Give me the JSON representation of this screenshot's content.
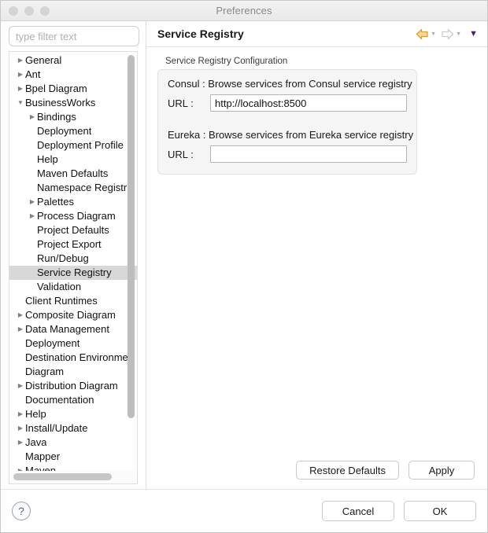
{
  "window": {
    "title": "Preferences",
    "traffic_lights": [
      "close",
      "minimize",
      "zoom"
    ]
  },
  "sidebar": {
    "filter": {
      "value": "",
      "placeholder": "type filter text"
    },
    "tree": [
      {
        "label": "General",
        "level": 0,
        "twisty": "collapsed",
        "selected": false
      },
      {
        "label": "Ant",
        "level": 0,
        "twisty": "collapsed",
        "selected": false
      },
      {
        "label": "Bpel Diagram",
        "level": 0,
        "twisty": "collapsed",
        "selected": false
      },
      {
        "label": "BusinessWorks",
        "level": 0,
        "twisty": "expanded",
        "selected": false
      },
      {
        "label": "Bindings",
        "level": 1,
        "twisty": "collapsed",
        "selected": false
      },
      {
        "label": "Deployment",
        "level": 1,
        "twisty": "none",
        "selected": false
      },
      {
        "label": "Deployment Profile",
        "level": 1,
        "twisty": "none",
        "selected": false
      },
      {
        "label": "Help",
        "level": 1,
        "twisty": "none",
        "selected": false
      },
      {
        "label": "Maven Defaults",
        "level": 1,
        "twisty": "none",
        "selected": false
      },
      {
        "label": "Namespace Registr",
        "level": 1,
        "twisty": "none",
        "selected": false
      },
      {
        "label": "Palettes",
        "level": 1,
        "twisty": "collapsed",
        "selected": false
      },
      {
        "label": "Process Diagram",
        "level": 1,
        "twisty": "collapsed",
        "selected": false
      },
      {
        "label": "Project Defaults",
        "level": 1,
        "twisty": "none",
        "selected": false
      },
      {
        "label": "Project Export",
        "level": 1,
        "twisty": "none",
        "selected": false
      },
      {
        "label": "Run/Debug",
        "level": 1,
        "twisty": "none",
        "selected": false
      },
      {
        "label": "Service Registry",
        "level": 1,
        "twisty": "none",
        "selected": true
      },
      {
        "label": "Validation",
        "level": 1,
        "twisty": "none",
        "selected": false
      },
      {
        "label": "Client Runtimes",
        "level": 0,
        "twisty": "none",
        "selected": false
      },
      {
        "label": "Composite Diagram",
        "level": 0,
        "twisty": "collapsed",
        "selected": false
      },
      {
        "label": "Data Management",
        "level": 0,
        "twisty": "collapsed",
        "selected": false
      },
      {
        "label": "Deployment",
        "level": 0,
        "twisty": "none",
        "selected": false
      },
      {
        "label": "Destination Environme",
        "level": 0,
        "twisty": "none",
        "selected": false
      },
      {
        "label": "Diagram",
        "level": 0,
        "twisty": "none",
        "selected": false
      },
      {
        "label": "Distribution Diagram",
        "level": 0,
        "twisty": "collapsed",
        "selected": false
      },
      {
        "label": "Documentation",
        "level": 0,
        "twisty": "none",
        "selected": false
      },
      {
        "label": "Help",
        "level": 0,
        "twisty": "collapsed",
        "selected": false
      },
      {
        "label": "Install/Update",
        "level": 0,
        "twisty": "collapsed",
        "selected": false
      },
      {
        "label": "Java",
        "level": 0,
        "twisty": "collapsed",
        "selected": false
      },
      {
        "label": "Mapper",
        "level": 0,
        "twisty": "none",
        "selected": false
      },
      {
        "label": "Maven",
        "level": 0,
        "twisty": "collapsed",
        "selected": false
      }
    ]
  },
  "panel": {
    "title": "Service Registry",
    "nav": {
      "back_icon": "back-arrow-icon",
      "forward_icon": "forward-arrow-icon",
      "menu_icon": "chevron-down-icon",
      "back_color": "#d9a22e",
      "forward_color": "#cccccc",
      "menu_color": "#4a1f66"
    },
    "group": {
      "title": "Service Registry Configuration",
      "registries": [
        {
          "description": "Consul : Browse services from Consul service registry",
          "url_label": "URL :",
          "url_value": "http://localhost:8500",
          "url_placeholder": ""
        },
        {
          "description": "Eureka : Browse services from Eureka service registry",
          "url_label": "URL :",
          "url_value": "",
          "url_placeholder": ""
        }
      ]
    },
    "actions": {
      "restore_defaults": "Restore Defaults",
      "apply": "Apply"
    }
  },
  "footer": {
    "help_icon": "question-mark-icon",
    "help_glyph": "?",
    "cancel": "Cancel",
    "ok": "OK"
  }
}
